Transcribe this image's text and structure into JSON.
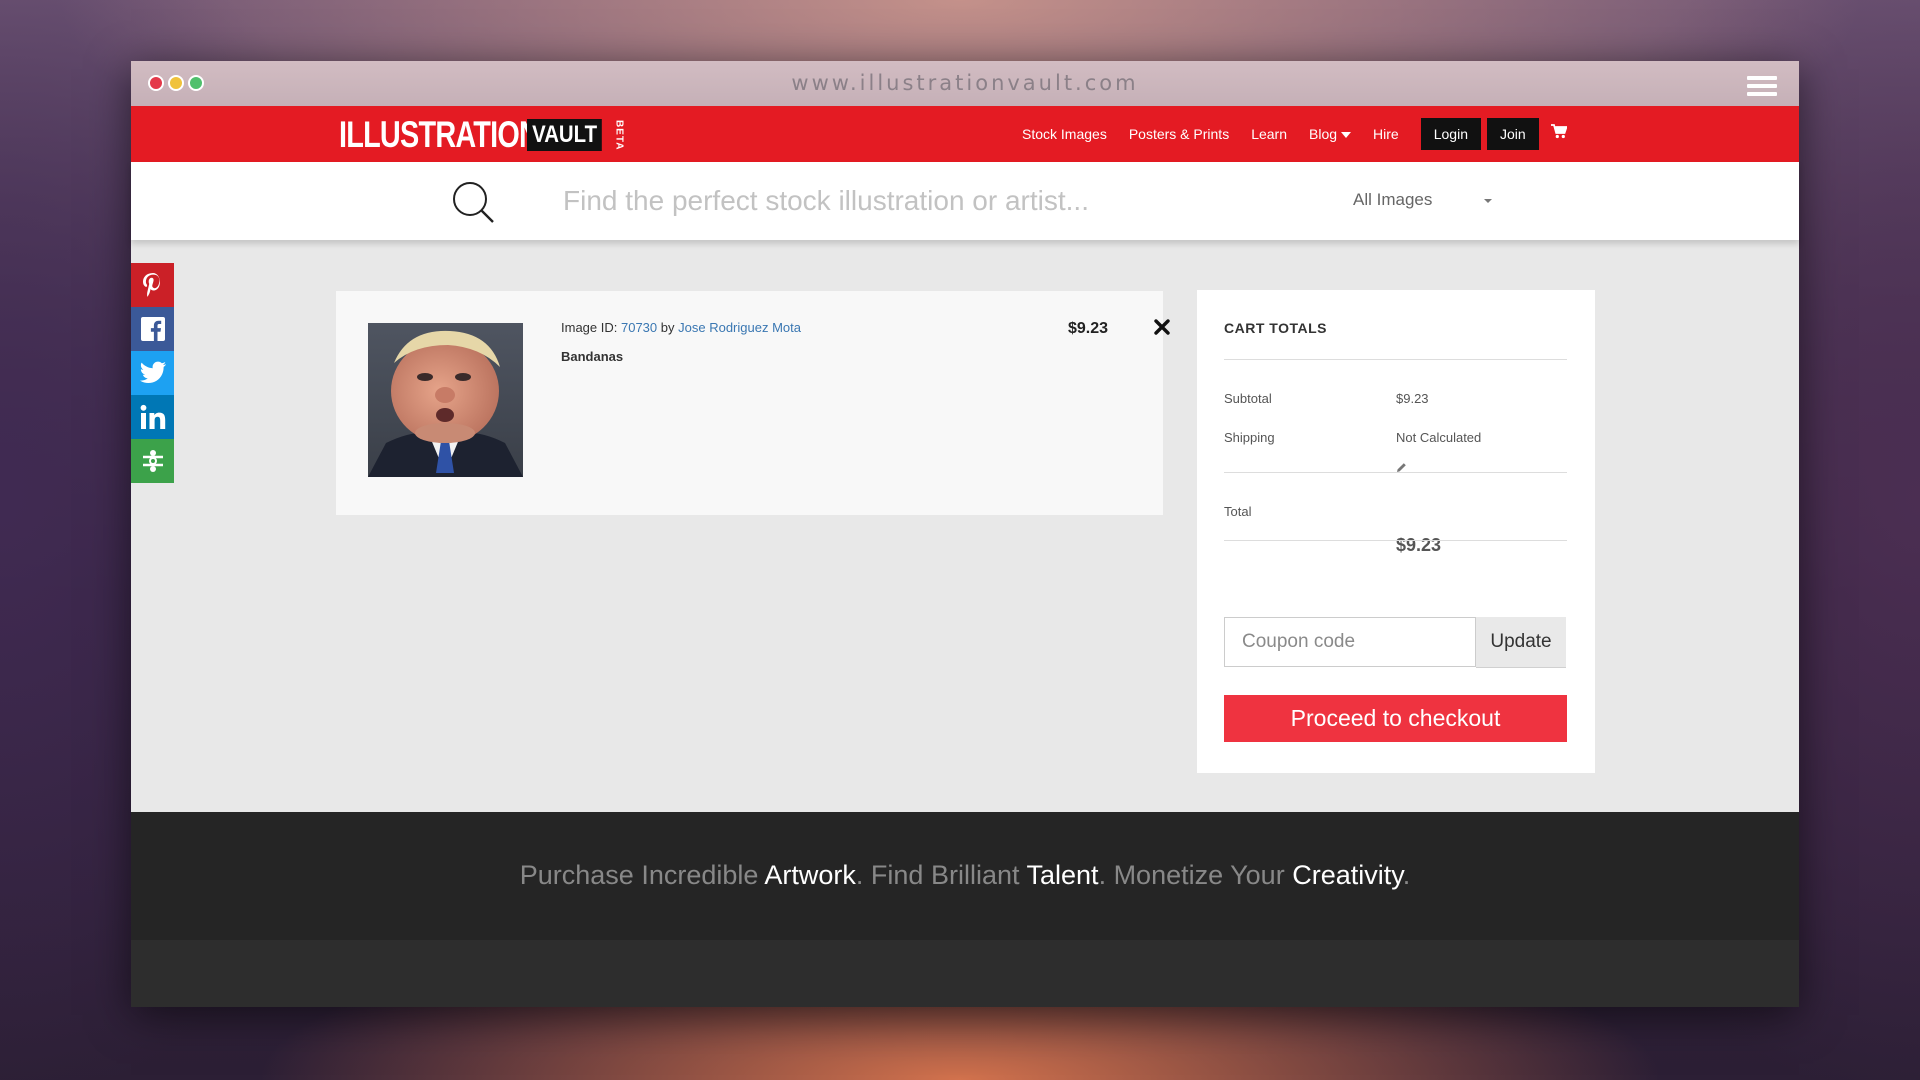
{
  "window": {
    "url": "www.illustrationvault.com",
    "controls": [
      "close",
      "minimize",
      "maximize"
    ],
    "menu_icon": "hamburger-menu-icon"
  },
  "site": {
    "logo": {
      "main": "ILLUSTRATION",
      "vault": "VAULT",
      "badge": "BETA"
    },
    "nav": {
      "stock_images": "Stock Images",
      "posters_prints": "Posters & Prints",
      "learn": "Learn",
      "blog": "Blog",
      "hire": "Hire",
      "login": "Login",
      "join": "Join"
    },
    "brand_color": "#e41b23"
  },
  "search": {
    "placeholder": "Find the perfect stock illustration or artist...",
    "category": "All Images"
  },
  "social": [
    "pinterest-icon",
    "facebook-icon",
    "twitter-icon",
    "linkedin-icon",
    "share-more-icon"
  ],
  "cart_item": {
    "id_label": "Image ID:",
    "id": "70730",
    "by": "by",
    "artist": "Jose Rodriguez Mota",
    "title": "Bandanas",
    "price": "$9.23",
    "remove_icon": "close-x-icon"
  },
  "cart_totals": {
    "title": "CART TOTALS",
    "subtotal_label": "Subtotal",
    "subtotal": "$9.23",
    "shipping_label": "Shipping",
    "shipping": "Not Calculated",
    "total_label": "Total",
    "total": "$9.23",
    "coupon_placeholder": "Coupon code",
    "update": "Update",
    "checkout": "Proceed to checkout",
    "checkout_color": "#ef3340"
  },
  "footer": {
    "p1": "Purchase Incredible ",
    "w1": "Artwork",
    "p2": ". Find Brilliant ",
    "w2": "Talent",
    "p3": ". Monetize Your ",
    "w3": "Creativity",
    "p4": "."
  }
}
